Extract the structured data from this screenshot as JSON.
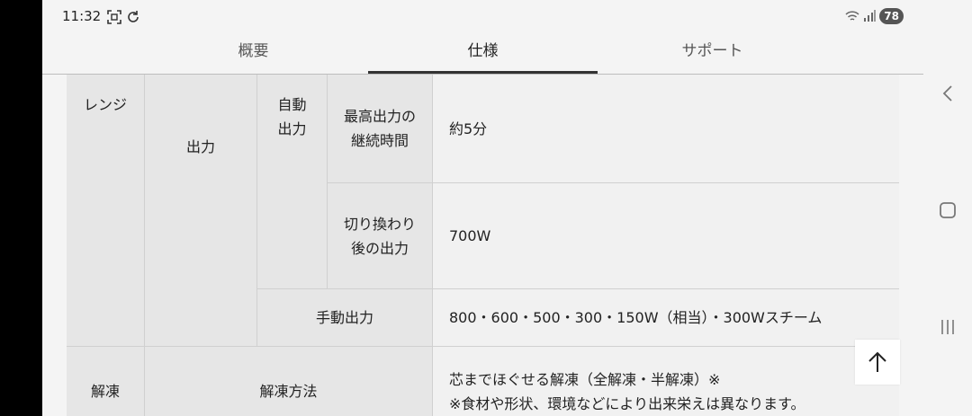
{
  "status_bar": {
    "time": "11:32",
    "battery": "78",
    "icons_left": [
      "screenshot-icon",
      "sync-icon"
    ],
    "icons_right": [
      "wifi-icon",
      "signal-icon"
    ]
  },
  "tabs": [
    {
      "label": "概要",
      "active": false
    },
    {
      "label": "仕様",
      "active": true
    },
    {
      "label": "サポート",
      "active": false
    }
  ],
  "spec_table": {
    "range": {
      "category": "レンジ",
      "output_label": "出力",
      "auto_output_label": "自動出力",
      "max_output_duration_label": "最高出力の継続時間",
      "max_output_duration_value": "約5分",
      "after_switch_label": "切り換わり後の出力",
      "after_switch_value": "700W",
      "manual_output_label": "手動出力",
      "manual_output_value": "800・600・500・300・150W（相当）・300Wスチーム"
    },
    "defrost": {
      "category": "解凍",
      "method_label": "解凍方法",
      "method_value_line1": "芯までほぐせる解凍（全解凍・半解凍）※",
      "method_value_line2": "※食材や形状、環境などにより出来栄えは異なります。"
    }
  },
  "nav_icons": [
    "back-icon",
    "home-icon",
    "recents-icon"
  ],
  "scroll_top_icon": "arrow-up-icon",
  "colors": {
    "header_cell": "#e6e6e6",
    "value_cell": "#f1f1f1",
    "background": "#f4f4f4"
  }
}
